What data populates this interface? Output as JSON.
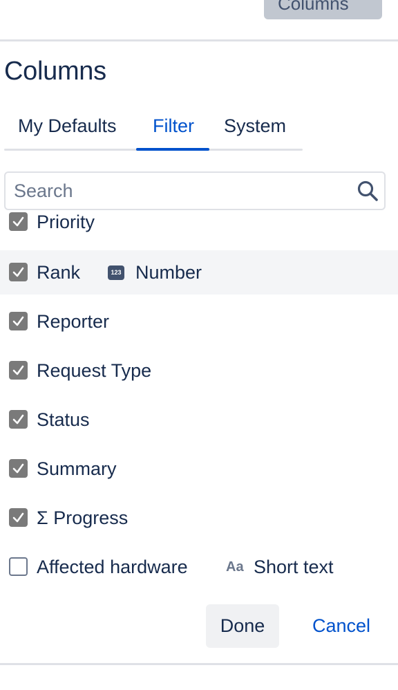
{
  "header": {
    "columns_button_label": "Columns"
  },
  "dialog": {
    "title": "Columns",
    "tabs": [
      {
        "label": "My Defaults",
        "active": false
      },
      {
        "label": "Filter",
        "active": true
      },
      {
        "label": "System",
        "active": false
      }
    ],
    "search": {
      "placeholder": "Search",
      "value": ""
    },
    "items": [
      {
        "label": "Priority",
        "checked": true,
        "type_icon": "",
        "type_label": ""
      },
      {
        "label": "Rank",
        "checked": true,
        "type_icon": "number-icon",
        "type_icon_text": "123",
        "type_label": "Number"
      },
      {
        "label": "Reporter",
        "checked": true,
        "type_icon": "",
        "type_label": ""
      },
      {
        "label": "Request Type",
        "checked": true,
        "type_icon": "",
        "type_label": ""
      },
      {
        "label": "Status",
        "checked": true,
        "type_icon": "",
        "type_label": ""
      },
      {
        "label": "Summary",
        "checked": true,
        "type_icon": "",
        "type_label": ""
      },
      {
        "label": "Σ Progress",
        "checked": true,
        "type_icon": "",
        "type_label": ""
      },
      {
        "label": "Affected hardware",
        "checked": false,
        "type_icon": "short-text-icon",
        "type_icon_text": "Aa",
        "type_label": "Short text"
      }
    ],
    "actions": {
      "done_label": "Done",
      "cancel_label": "Cancel"
    }
  },
  "colors": {
    "accent": "#0052cc",
    "text": "#172b4d",
    "checkbox_checked": "#7a7a7a",
    "row_highlight": "#f4f5f7"
  }
}
